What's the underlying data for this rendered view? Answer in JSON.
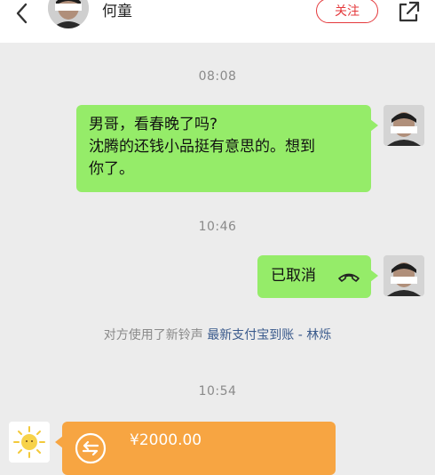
{
  "header": {
    "back_icon": "chevron-left-icon",
    "contact_name": "何童",
    "follow_label": "关注",
    "share_icon": "external-share-icon",
    "accent": "#e4393c"
  },
  "chat": {
    "timestamps": [
      "08:08",
      "10:46",
      "10:54"
    ],
    "message_1": {
      "lines": [
        "男哥，看春晚了吗?",
        "沈腾的还钱小品挺有意思的。想到",
        "你了。"
      ]
    },
    "message_2": {
      "text": "已取消",
      "icon": "hang-up-phone-icon"
    },
    "system_note": {
      "prefix": "对方使用了新铃声 ",
      "link": "最新支付宝到账 - 林烁"
    },
    "transfer": {
      "amount": "¥2000.00",
      "icon": "transfer-arrow-icon",
      "avatar_icon": "sun-icon"
    },
    "bubble_color": "#95ec69",
    "transfer_color": "#f7a542"
  }
}
